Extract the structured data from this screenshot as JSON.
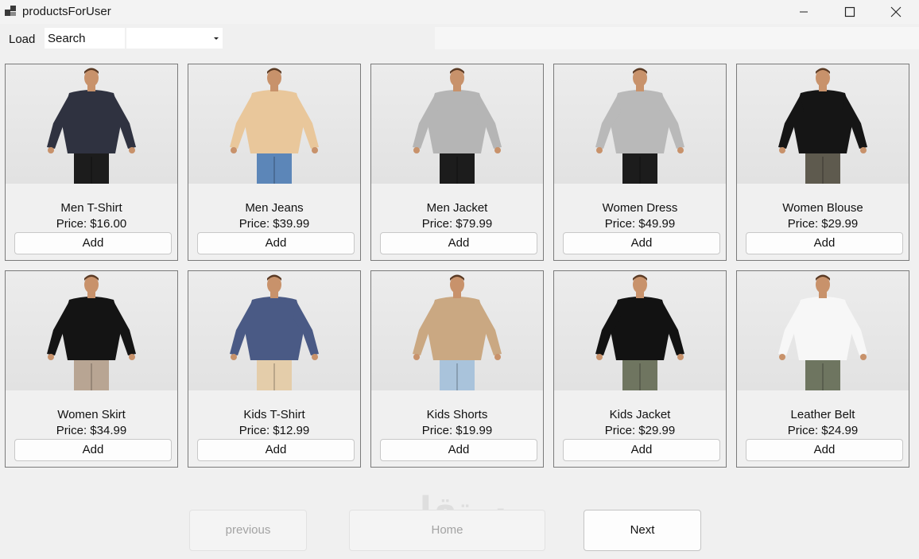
{
  "window": {
    "title": "productsForUser"
  },
  "toolbar": {
    "load_label": "Load",
    "search_value": "Search",
    "filter_value": ""
  },
  "products": [
    {
      "name": "Men T-Shirt",
      "price": "Price: $16.00",
      "button": "Add",
      "top_color": "#2f3240",
      "bottom_color": "#1c1c1c"
    },
    {
      "name": "Men Jeans",
      "price": "Price: $39.99",
      "button": "Add",
      "top_color": "#e9c79b",
      "bottom_color": "#5c86b8"
    },
    {
      "name": "Men Jacket",
      "price": "Price: $79.99",
      "button": "Add",
      "top_color": "#b5b5b5",
      "bottom_color": "#1c1c1c"
    },
    {
      "name": "Women Dress",
      "price": "Price: $49.99",
      "button": "Add",
      "top_color": "#b9b9b9",
      "bottom_color": "#1c1c1c"
    },
    {
      "name": "Women Blouse",
      "price": "Price: $29.99",
      "button": "Add",
      "top_color": "#151515",
      "bottom_color": "#5e5a4e"
    },
    {
      "name": "Women Skirt",
      "price": "Price: $34.99",
      "button": "Add",
      "top_color": "#141414",
      "bottom_color": "#b8a593"
    },
    {
      "name": "Kids T-Shirt",
      "price": "Price: $12.99",
      "button": "Add",
      "top_color": "#4a5a85",
      "bottom_color": "#e4cdaa"
    },
    {
      "name": "Kids Shorts",
      "price": "Price: $19.99",
      "button": "Add",
      "top_color": "#caa882",
      "bottom_color": "#a9c3db"
    },
    {
      "name": "Kids Jacket",
      "price": "Price: $29.99",
      "button": "Add",
      "top_color": "#121212",
      "bottom_color": "#6f7560"
    },
    {
      "name": "Leather Belt",
      "price": "Price: $24.99",
      "button": "Add",
      "top_color": "#f7f7f7",
      "bottom_color": "#6e7560"
    }
  ],
  "nav": {
    "previous": "previous",
    "home": "Home",
    "next": "Next"
  },
  "watermark": {
    "arabic": "مستقل",
    "latin": "mostaql.com"
  }
}
